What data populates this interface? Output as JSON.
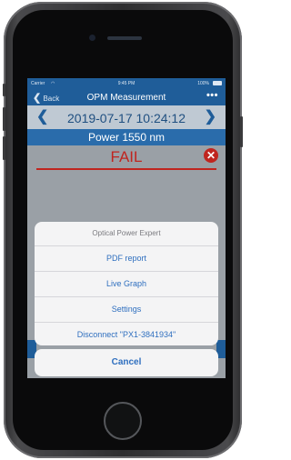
{
  "status_bar": {
    "carrier": "Carrier",
    "time": "9:45 PM",
    "battery": "100%"
  },
  "nav": {
    "back_label": "Back",
    "title": "OPM Measurement",
    "more_label": "•••"
  },
  "measurement": {
    "date": "2019-07-17 10:24:12",
    "prev_label": "<",
    "next_label": ">",
    "power": "Power  1550 nm",
    "result": "FAIL",
    "result_icon": "✕"
  },
  "action_sheet": {
    "title": "Optical Power Expert",
    "items": [
      {
        "label": "PDF report"
      },
      {
        "label": "Live Graph"
      },
      {
        "label": "Settings"
      },
      {
        "label": "Disconnect \"PX1-3841934\""
      }
    ],
    "cancel_label": "Cancel"
  },
  "colors": {
    "nav_blue": "#1f5d99",
    "power_blue": "#2a6cab",
    "fail_red": "#c0251f",
    "action_blue": "#2f6fbf"
  },
  "icons": [
    "back-chevron-icon",
    "more-icon",
    "prev-arrow-icon",
    "next-arrow-icon",
    "fail-x-icon",
    "wifi-icon",
    "battery-icon"
  ]
}
